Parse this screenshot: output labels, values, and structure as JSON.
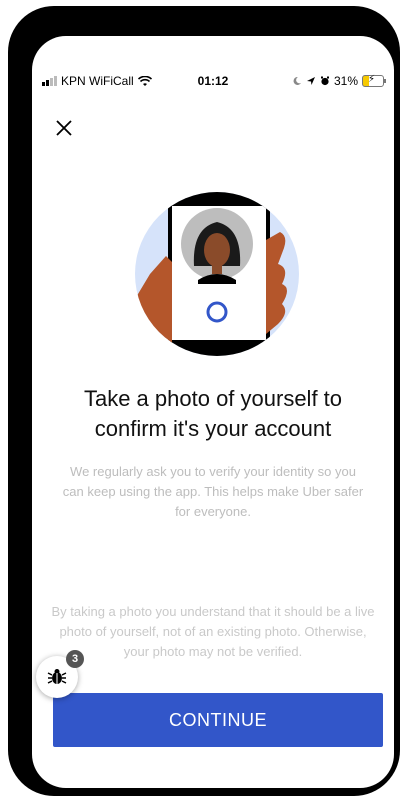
{
  "status_bar": {
    "carrier": "KPN WiFiCall",
    "time": "01:12",
    "battery": "31%",
    "battery_level": 0.31,
    "icons": [
      "signal-icon",
      "wifi-icon",
      "moon-icon",
      "location-icon",
      "alarm-icon",
      "battery-icon"
    ]
  },
  "screen": {
    "close_icon": "close-icon",
    "title": "Take a photo of yourself to confirm it's your account",
    "subtitle": "We regularly ask you to verify your identity so you can keep using the app. This helps make Uber safer for everyone.",
    "disclaimer": "By taking a photo you understand that it should be a live photo of yourself, not of an existing photo. Otherwise, your photo may not be verified.",
    "continue_label": "CONTINUE"
  },
  "debug_widget": {
    "icon": "bug-icon",
    "badge": "3"
  },
  "colors": {
    "accent": "#3256c9",
    "illustration_bg": "#d6e3fa",
    "hand": "#b4562b",
    "phone": "#000000",
    "text_muted": "#bdbdbd"
  }
}
